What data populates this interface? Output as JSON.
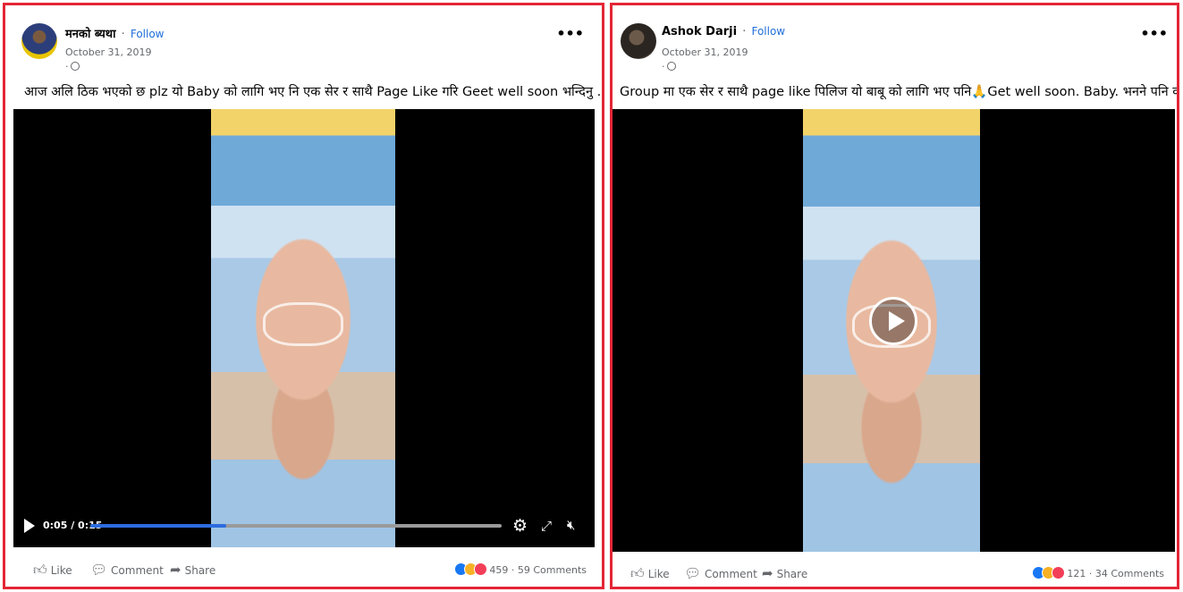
{
  "colors": {
    "border": "#e32636",
    "follow": "#216fdb",
    "progress": "#2d6cdf"
  },
  "posts": [
    {
      "author": "मनको ब्यथा",
      "separator": "·",
      "follow": "Follow",
      "date": "October 31, 2019",
      "privacy": "·",
      "caption": "आज अलि ठिक भएको छ plz यो Baby को लागि भए नि एक सेर र साथै Page Like गरि Geet well soon भन्दिनु ...",
      "video": {
        "time": "0:05 / 0:15",
        "progress": 0.33,
        "state": "playing"
      },
      "actions": {
        "like": "Like",
        "comment": "Comment",
        "share": "Share"
      },
      "reaction_count": "459",
      "comments": "59 Comments"
    },
    {
      "author": "Ashok Darji",
      "separator": "·",
      "follow": "Follow",
      "date": "October 31, 2019",
      "privacy": "·",
      "caption": "Group मा एक सेर र साथै page like पिलिज यो बाबू को लागि भए पनि🙏Get well soon. Baby. भनने पनि कोइ ...",
      "video": {
        "state": "paused"
      },
      "actions": {
        "like": "Like",
        "comment": "Comment",
        "share": "Share"
      },
      "reaction_count": "121",
      "comments": "34 Comments"
    }
  ],
  "icons": [
    "more-icon",
    "globe-icon",
    "play-icon",
    "gear-icon",
    "fullscreen-icon",
    "mute-icon",
    "like-icon",
    "comment-icon",
    "share-icon"
  ]
}
